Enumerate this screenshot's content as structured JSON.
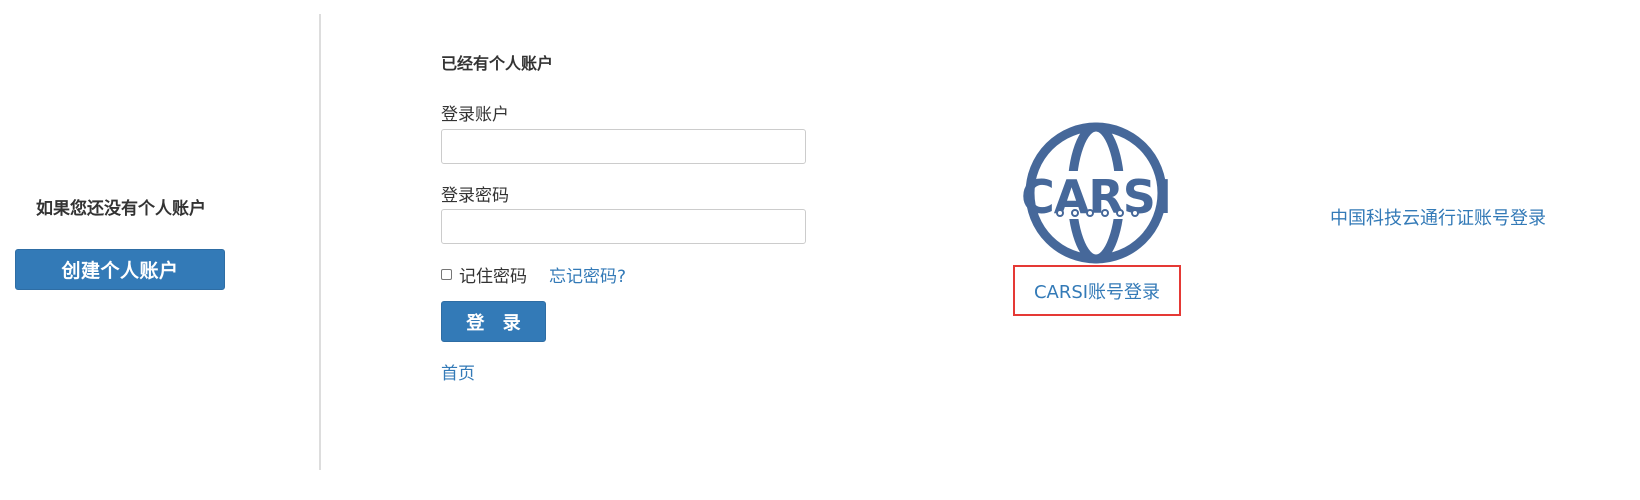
{
  "register": {
    "prompt": "如果您还没有个人账户",
    "create_button": "创建个人账户"
  },
  "login_form": {
    "heading": "已经有个人账户",
    "account_label": "登录账户",
    "account_value": "",
    "password_label": "登录密码",
    "password_value": "",
    "remember_label": "记住密码",
    "remember_checked": false,
    "forgot_link": "忘记密码?",
    "submit_button": "登 录",
    "home_link": "首页"
  },
  "third_party": {
    "carsi_logo_text": "CARSI",
    "carsi_logo_color": "#46689a",
    "carsi_link": "CARSI账号登录",
    "carsi_highlight_color": "#e53935",
    "cstcloud_link": "中国科技云通行证账号登录"
  },
  "colors": {
    "primary": "#337ab7",
    "link": "#337ab7",
    "text": "#333333"
  }
}
